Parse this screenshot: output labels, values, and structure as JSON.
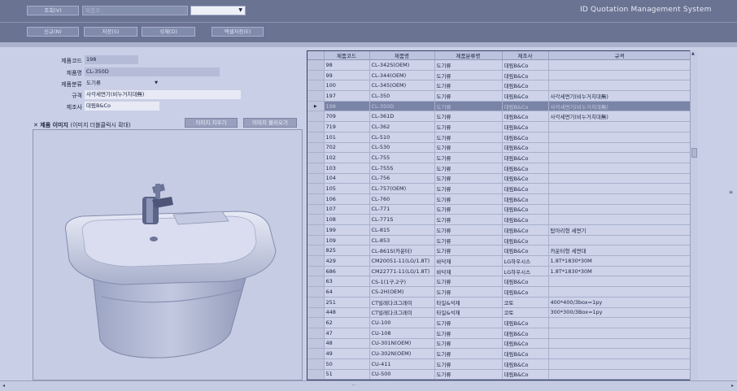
{
  "app_title": "ID Quotation Management System",
  "topbar": {
    "search_button": "조회(V)",
    "search_placeholder": "제품코",
    "category_value": ""
  },
  "toolbar": {
    "new_button": "신규(N)",
    "save_button": "저장(S)",
    "delete_button": "삭제(D)",
    "excel_button": "엑셀저장(E)"
  },
  "form": {
    "code_label": "제품코드",
    "code_value": "198",
    "name_label": "제품명",
    "name_value": "CL-350D",
    "category_label": "제품분류",
    "category_value": "도기류",
    "spec_label": "규격",
    "spec_value": "사각세면기(비누거치대無)",
    "maker_label": "제조사",
    "maker_value": "대림B&Co"
  },
  "image_panel": {
    "title": "✕ 제품 이미지",
    "hint": "(이미지 더블클릭시 확대)",
    "clear_button": "이미지 지우기",
    "load_button": "이미지 불러오기"
  },
  "grid": {
    "columns": [
      "제품코드",
      "제품명",
      "제품분류명",
      "제조사",
      "규격"
    ],
    "selected_index": 4,
    "rows": [
      [
        "98",
        "CL-342S(OEM)",
        "도기류",
        "대림B&Co",
        ""
      ],
      [
        "99",
        "CL-344(OEM)",
        "도기류",
        "대림B&Co",
        ""
      ],
      [
        "100",
        "CL-345(OEM)",
        "도기류",
        "대림B&Co",
        ""
      ],
      [
        "197",
        "CL-350",
        "도기류",
        "대림B&Co",
        "사각세면기(비누거치대無)"
      ],
      [
        "198",
        "CL-350D",
        "도기류",
        "대림B&Co",
        "사각세면기(비누거치대無)"
      ],
      [
        "709",
        "CL-361D",
        "도기류",
        "대림B&Co",
        "사각세면기(비누거치대無)"
      ],
      [
        "719",
        "CL-362",
        "도기류",
        "대림B&Co",
        ""
      ],
      [
        "101",
        "CL-510",
        "도기류",
        "대림B&Co",
        ""
      ],
      [
        "702",
        "CL-530",
        "도기류",
        "대림B&Co",
        ""
      ],
      [
        "102",
        "CL-755",
        "도기류",
        "대림B&Co",
        ""
      ],
      [
        "103",
        "CL-755S",
        "도기류",
        "대림B&Co",
        ""
      ],
      [
        "104",
        "CL-756",
        "도기류",
        "대림B&Co",
        ""
      ],
      [
        "105",
        "CL-757(OEM)",
        "도기류",
        "대림B&Co",
        ""
      ],
      [
        "106",
        "CL-760",
        "도기류",
        "대림B&Co",
        ""
      ],
      [
        "107",
        "CL-771",
        "도기류",
        "대림B&Co",
        ""
      ],
      [
        "108",
        "CL-771S",
        "도기류",
        "대림B&Co",
        ""
      ],
      [
        "199",
        "CL-815",
        "도기류",
        "대림B&Co",
        "탑아리형 세면기"
      ],
      [
        "109",
        "CL-853",
        "도기류",
        "대림B&Co",
        ""
      ],
      [
        "825",
        "CL-861S(카운터)",
        "도기류",
        "대림B&Co",
        "카운터형 세면대"
      ],
      [
        "429",
        "CM20051-11(LG/1.8T)",
        "바닥재",
        "LG하우시스",
        "1.8T*1830*30M"
      ],
      [
        "686",
        "CM22771-11(LG/1.8T)",
        "바닥재",
        "LG하우시스",
        "1.8T*1830*30M"
      ],
      [
        "63",
        "CS-1(1구,2구)",
        "도기류",
        "대림B&Co",
        ""
      ],
      [
        "64",
        "CS-2H(OEM)",
        "도기류",
        "대림B&Co",
        ""
      ],
      [
        "251",
        "CT빌레다크그레이",
        "타일&석재",
        "코토",
        "400*400/3box=1py"
      ],
      [
        "448",
        "CT빌레다크그레이",
        "타일&석재",
        "코토",
        "300*300/3Box=1py"
      ],
      [
        "62",
        "CU-100",
        "도기류",
        "대림B&Co",
        ""
      ],
      [
        "47",
        "CU-108",
        "도기류",
        "대림B&Co",
        ""
      ],
      [
        "48",
        "CU-301N(OEM)",
        "도기류",
        "대림B&Co",
        ""
      ],
      [
        "49",
        "CU-302N(OEM)",
        "도기류",
        "대림B&Co",
        ""
      ],
      [
        "50",
        "CU-411",
        "도기류",
        "대림B&Co",
        ""
      ],
      [
        "51",
        "CU-500",
        "도기류",
        "대림B&Co",
        ""
      ]
    ]
  }
}
